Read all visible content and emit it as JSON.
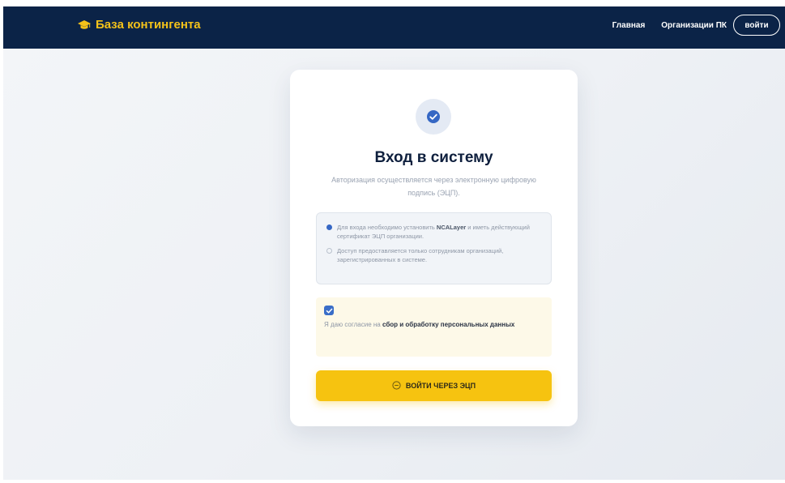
{
  "navbar": {
    "brand": "База контингента",
    "brand_icon": "graduation-cap-icon",
    "links": [
      "Главная",
      "Организации ПК"
    ],
    "login_label": "войти"
  },
  "card": {
    "icon": "shield-check-icon",
    "title": "Вход в систему",
    "subtitle": "Авторизация осуществляется через электронную цифровую подпись (ЭЦП).",
    "info": {
      "row1_prefix": "Для входа необходимо установить ",
      "row1_bold": "NCALayer",
      "row1_suffix": " и иметь действующий сертификат ЭЦП организации.",
      "row2": "Доступ предоставляется только сотрудникам организаций, зарегистрированных в системе."
    },
    "consent": {
      "checked": true,
      "prefix": "Я даю согласие на ",
      "bold": "сбор и обработку персональных данных"
    },
    "submit_label": "ВОЙТИ ЧЕРЕЗ ЭЦП"
  },
  "colors": {
    "navbar_bg": "#0b2347",
    "brand": "#f4c21a",
    "accent_button": "#f6c310",
    "checkbox": "#3a6ec8"
  }
}
